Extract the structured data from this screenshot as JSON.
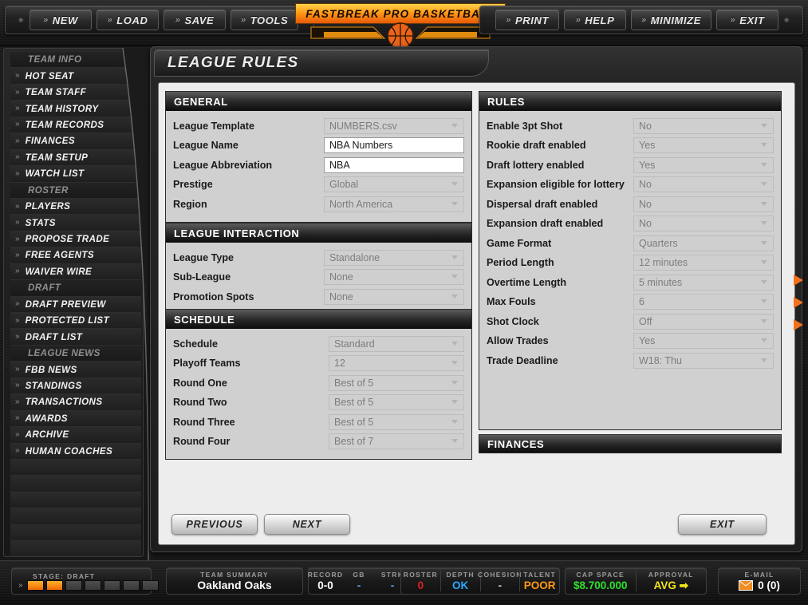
{
  "app": {
    "title": "FASTBREAK PRO BASKETBALL"
  },
  "topmenu": {
    "left": [
      {
        "label": "NEW"
      },
      {
        "label": "LOAD"
      },
      {
        "label": "SAVE"
      },
      {
        "label": "TOOLS"
      }
    ],
    "right": [
      {
        "label": "PRINT"
      },
      {
        "label": "HELP"
      },
      {
        "label": "MINIMIZE"
      },
      {
        "label": "EXIT"
      }
    ],
    "chevron": "»"
  },
  "sidebar": {
    "items": [
      {
        "label": "TEAM INFO",
        "type": "header"
      },
      {
        "label": "HOT SEAT",
        "type": "item"
      },
      {
        "label": "TEAM STAFF",
        "type": "item"
      },
      {
        "label": "TEAM HISTORY",
        "type": "item"
      },
      {
        "label": "TEAM RECORDS",
        "type": "item"
      },
      {
        "label": "FINANCES",
        "type": "item"
      },
      {
        "label": "TEAM SETUP",
        "type": "item"
      },
      {
        "label": "WATCH LIST",
        "type": "item"
      },
      {
        "label": "ROSTER",
        "type": "header"
      },
      {
        "label": "PLAYERS",
        "type": "item"
      },
      {
        "label": "STATS",
        "type": "item"
      },
      {
        "label": "PROPOSE TRADE",
        "type": "item"
      },
      {
        "label": "FREE AGENTS",
        "type": "item"
      },
      {
        "label": "WAIVER WIRE",
        "type": "item"
      },
      {
        "label": "DRAFT",
        "type": "header"
      },
      {
        "label": "DRAFT PREVIEW",
        "type": "item"
      },
      {
        "label": "PROTECTED LIST",
        "type": "item"
      },
      {
        "label": "DRAFT LIST",
        "type": "item"
      },
      {
        "label": "LEAGUE NEWS",
        "type": "header"
      },
      {
        "label": "FBB NEWS",
        "type": "item"
      },
      {
        "label": "STANDINGS",
        "type": "item"
      },
      {
        "label": "TRANSACTIONS",
        "type": "item"
      },
      {
        "label": "AWARDS",
        "type": "item"
      },
      {
        "label": "ARCHIVE",
        "type": "item"
      },
      {
        "label": "HUMAN COACHES",
        "type": "item"
      },
      {
        "label": "",
        "type": "empty"
      },
      {
        "label": "",
        "type": "empty"
      },
      {
        "label": "",
        "type": "empty"
      },
      {
        "label": "",
        "type": "empty"
      },
      {
        "label": "",
        "type": "empty"
      },
      {
        "label": "",
        "type": "empty"
      }
    ],
    "chevron": "»"
  },
  "page": {
    "title": "LEAGUE RULES"
  },
  "sections": {
    "general": {
      "title": "GENERAL",
      "rows": [
        {
          "label": "League Template",
          "value": "NUMBERS.csv",
          "kind": "select"
        },
        {
          "label": "League Name",
          "value": "NBA Numbers",
          "kind": "text"
        },
        {
          "label": "League Abbreviation",
          "value": "NBA",
          "kind": "text"
        },
        {
          "label": "Prestige",
          "value": "Global",
          "kind": "select"
        },
        {
          "label": "Region",
          "value": "North America",
          "kind": "select"
        }
      ]
    },
    "league_interaction": {
      "title": "LEAGUE INTERACTION",
      "rows": [
        {
          "label": "League Type",
          "value": "Standalone",
          "kind": "select"
        },
        {
          "label": "Sub-League",
          "value": "None",
          "kind": "select"
        },
        {
          "label": "Promotion Spots",
          "value": "None",
          "kind": "select"
        }
      ]
    },
    "schedule": {
      "title": "SCHEDULE",
      "rows": [
        {
          "label": "Schedule",
          "value": "Standard",
          "kind": "select"
        },
        {
          "label": "Playoff Teams",
          "value": "12",
          "kind": "select"
        },
        {
          "label": "Round One",
          "value": "Best of 5",
          "kind": "select"
        },
        {
          "label": "Round Two",
          "value": "Best of 5",
          "kind": "select"
        },
        {
          "label": "Round Three",
          "value": "Best of 5",
          "kind": "select"
        },
        {
          "label": "Round Four",
          "value": "Best of 7",
          "kind": "select"
        }
      ]
    },
    "rules": {
      "title": "RULES",
      "rows": [
        {
          "label": "Enable 3pt Shot",
          "value": "No",
          "kind": "select"
        },
        {
          "label": "Rookie draft enabled",
          "value": "Yes",
          "kind": "select"
        },
        {
          "label": "Draft lottery enabled",
          "value": "Yes",
          "kind": "select"
        },
        {
          "label": "Expansion eligible for lottery",
          "value": "No",
          "kind": "select"
        },
        {
          "label": "Dispersal draft enabled",
          "value": "No",
          "kind": "select"
        },
        {
          "label": "Expansion draft enabled",
          "value": "No",
          "kind": "select"
        },
        {
          "label": "Game Format",
          "value": "Quarters",
          "kind": "select"
        },
        {
          "label": "Period Length",
          "value": "12 minutes",
          "kind": "select"
        },
        {
          "label": "Overtime Length",
          "value": "5 minutes",
          "kind": "select"
        },
        {
          "label": "Max Fouls",
          "value": "6",
          "kind": "select"
        },
        {
          "label": "Shot Clock",
          "value": "Off",
          "kind": "select"
        },
        {
          "label": "Allow Trades",
          "value": "Yes",
          "kind": "select"
        },
        {
          "label": "Trade Deadline",
          "value": "W18: Thu",
          "kind": "select"
        }
      ]
    },
    "finances": {
      "title": "FINANCES",
      "rows": []
    }
  },
  "footer_buttons": {
    "previous": "PREVIOUS",
    "next": "NEXT",
    "exit": "EXIT"
  },
  "statusbar": {
    "stage": {
      "caption": "STAGE: DRAFT",
      "filled": 2,
      "total": 7,
      "chevron": "»"
    },
    "team_summary": {
      "caption": "TEAM SUMMARY",
      "team": "Oakland Oaks"
    },
    "record_group": [
      {
        "caption": "RECORD",
        "value": "0-0",
        "color": "#ffffff"
      },
      {
        "caption": "GB",
        "value": "-",
        "color": "#4aa3ff"
      },
      {
        "caption": "STRK",
        "value": "-",
        "color": "#4aa3ff"
      }
    ],
    "roster_group": [
      {
        "caption": "ROSTER",
        "value": "0",
        "color": "#e02020"
      },
      {
        "caption": "DEPTH",
        "value": "OK",
        "color": "#29a8ff"
      },
      {
        "caption": "COHESION",
        "value": "-",
        "color": "#c9c9c9"
      },
      {
        "caption": "TALENT",
        "value": "POOR",
        "color": "#ff9a14"
      }
    ],
    "money_group": [
      {
        "caption": "CAP SPACE",
        "value": "$8.700.000",
        "color": "#2ee02e"
      },
      {
        "caption": "APPROVAL",
        "value": "AVG ➡",
        "color": "#f2e41c"
      }
    ],
    "email": {
      "caption": "E-MAIL",
      "value": "0 (0)",
      "icon": "envelope-icon"
    }
  },
  "colors": {
    "accent_orange": "#f2711c",
    "panel_bg": "#ededed",
    "section_bg": "#d0d0d0"
  }
}
